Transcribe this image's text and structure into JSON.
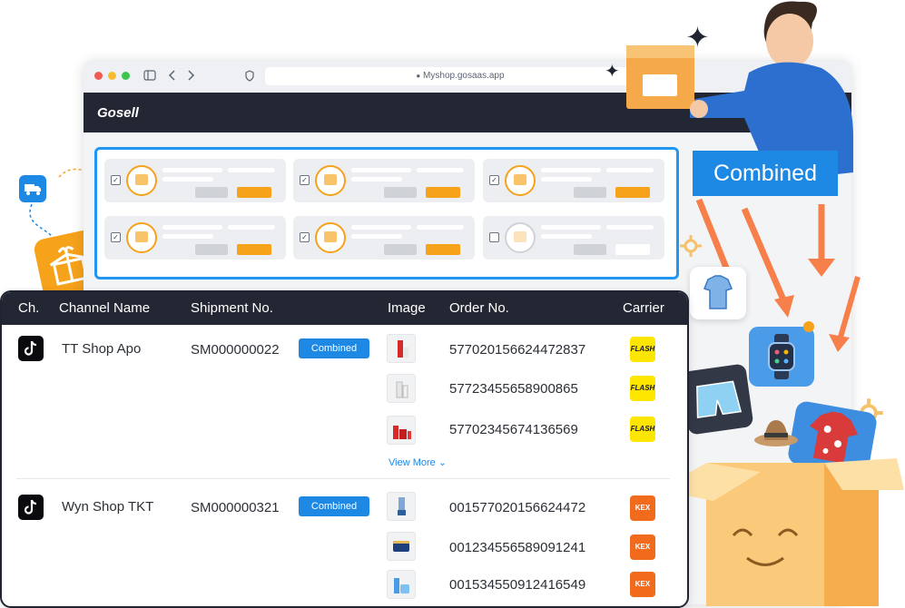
{
  "browser": {
    "url": "Myshop.gosaas.app",
    "logo": "Gosell"
  },
  "hero_label": "Combined",
  "table": {
    "headers": [
      "Ch.",
      "Channel Name",
      "Shipment No.",
      "Image",
      "Order No.",
      "Carrier"
    ],
    "groups": [
      {
        "channel_name": "TT Shop Apo",
        "shipment_no": "SM000000022",
        "status": "Combined",
        "orders": [
          "577020156624472837",
          "57723455658900865",
          "57702345674136569"
        ],
        "carrier": "FLASH",
        "view_more": "View More"
      },
      {
        "channel_name": "Wyn Shop TKT",
        "shipment_no": "SM000000321",
        "status": "Combined",
        "orders": [
          "001577020156624472",
          "001234556589091241",
          "001534550912416549"
        ],
        "carrier": "KEX"
      }
    ]
  },
  "colors": {
    "accent": "#1e88e5",
    "orange": "#f7a21b",
    "dark": "#232733"
  }
}
